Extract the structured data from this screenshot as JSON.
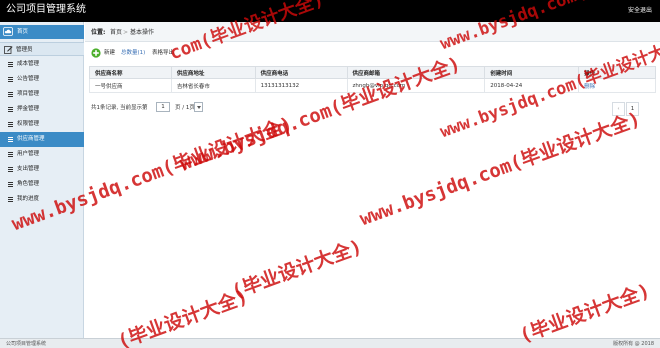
{
  "app": {
    "title": "公司项目管理系统",
    "logout_label": "安全退出"
  },
  "sidebar": {
    "home_label": "首页",
    "admin_label": "管理员",
    "items": [
      {
        "label": "成本管理",
        "active": false
      },
      {
        "label": "公告管理",
        "active": false
      },
      {
        "label": "项目管理",
        "active": false
      },
      {
        "label": "押金管理",
        "active": false
      },
      {
        "label": "权限管理",
        "active": false
      },
      {
        "label": "供应商管理",
        "active": true
      },
      {
        "label": "用户管理",
        "active": false
      },
      {
        "label": "支出管理",
        "active": false
      },
      {
        "label": "角色管理",
        "active": false
      },
      {
        "label": "我的进度",
        "active": false
      }
    ]
  },
  "breadcrumb": {
    "position_label": "位置:",
    "home": "首页",
    "separator": ">",
    "current": "基本操作"
  },
  "toolbar": {
    "add_label": "新建",
    "total_label": "总数量(1)",
    "export_label": "表格导出"
  },
  "table": {
    "headers": [
      "供应商名称",
      "供应商地址",
      "供应商电话",
      "供应商邮箱",
      "创建时间",
      "操作"
    ],
    "rows": [
      {
        "name": "一号供应商",
        "address": "吉林省长春市",
        "phone": "13131313132",
        "email": "zhngh@vip.qq.com",
        "created": "2018-04-24",
        "action": "删除"
      }
    ]
  },
  "pager": {
    "info_text": "共1条记录, 当前显示第",
    "page_value": "1",
    "of_text": "页 / 1页",
    "prev_label": "‹",
    "current_page": "1"
  },
  "status": {
    "left": "公司项目管理系统",
    "right": "版权所有 @ 2018"
  },
  "watermarks": [
    "com(毕业设计大全)",
    "www.bysjdq.com(毕业设计大全)",
    "www.bysjdq.com(毕业设计大全)",
    "www.bysjdq.com(毕业设计大全)",
    "www.bysjdq.com(毕业设计大全)",
    "www.bysjdq.com(毕业设计大全)",
    "(毕业设计大全)",
    "(毕业设计大全)",
    "(毕业设计大全)"
  ],
  "colors": {
    "topbar": "#000000",
    "accent": "#3b8bc6",
    "link": "#3a70b5",
    "watermark": "#cd0a0a"
  }
}
